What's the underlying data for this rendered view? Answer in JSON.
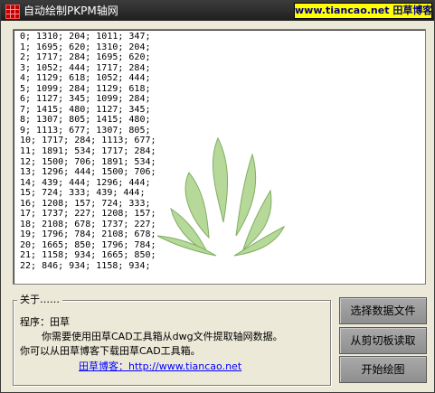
{
  "window": {
    "title": "自动绘制PKPM轴网",
    "brand": {
      "site": "www.tiancao.net",
      "name": "田草博客"
    }
  },
  "data_lines": [
    "0; 1310; 204; 1011; 347;",
    "1; 1695; 620; 1310; 204;",
    "2; 1717; 284; 1695; 620;",
    "3; 1052; 444; 1717; 284;",
    "4; 1129; 618; 1052; 444;",
    "5; 1099; 284; 1129; 618;",
    "6; 1127; 345; 1099; 284;",
    "7; 1415; 480; 1127; 345;",
    "8; 1307; 805; 1415; 480;",
    "9; 1113; 677; 1307; 805;",
    "10; 1717; 284; 1113; 677;",
    "11; 1891; 534; 1717; 284;",
    "12; 1500; 706; 1891; 534;",
    "13; 1296; 444; 1500; 706;",
    "14; 439; 444; 1296; 444;",
    "15; 724; 333; 439; 444;",
    "16; 1208; 157; 724; 333;",
    "17; 1737; 227; 1208; 157;",
    "18; 2108; 678; 1737; 227;",
    "19; 1796; 784; 2108; 678;",
    "20; 1665; 850; 1796; 784;",
    "21; 1158; 934; 1665; 850;",
    "22; 846; 934; 1158; 934;"
  ],
  "about": {
    "legend": "关于……",
    "line1": "程序：田草",
    "line2": "你需要使用田草CAD工具箱从dwg文件提取轴网数据。",
    "line3": "你可以从田草博客下载田草CAD工具箱。",
    "link": "田草博客：http://www.tiancao.net"
  },
  "buttons": {
    "select_file": "选择数据文件",
    "from_clipboard": "从剪切板读取",
    "start_draw": "开始绘图"
  },
  "colors": {
    "titlebar": "#2b2b2b",
    "brand_bg": "#ffff00",
    "brand_text": "#000080",
    "watermark": "#a8d08d",
    "link": "#0000ff",
    "button_bg": "#9c9c9c",
    "window_bg": "#ECE9D8"
  },
  "icons": {
    "app": "app-grid-icon",
    "watermark": "grass-logo-icon"
  }
}
